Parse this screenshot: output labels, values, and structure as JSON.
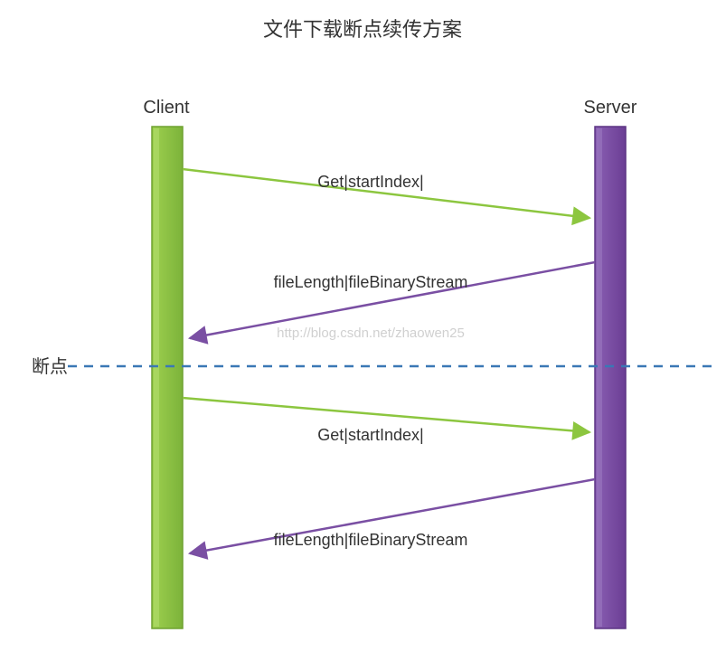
{
  "title": "文件下载断点续传方案",
  "client_label": "Client",
  "server_label": "Server",
  "breakpoint_label": "断点",
  "messages": {
    "get1": "Get|startIndex|",
    "resp1": "fileLength|fileBinaryStream",
    "get2": "Get|startIndex|",
    "resp2": "fileLength|fileBinaryStream"
  },
  "watermark": "http://blog.csdn.net/zhaowen25",
  "colors": {
    "client_fill": "#8CC63F",
    "client_stroke": "#7FB239",
    "server_fill": "#7A4FA3",
    "server_stroke": "#6B3E94",
    "arrow_green": "#8CC63F",
    "arrow_purple": "#7A4FA3",
    "dash": "#3A78B5"
  }
}
